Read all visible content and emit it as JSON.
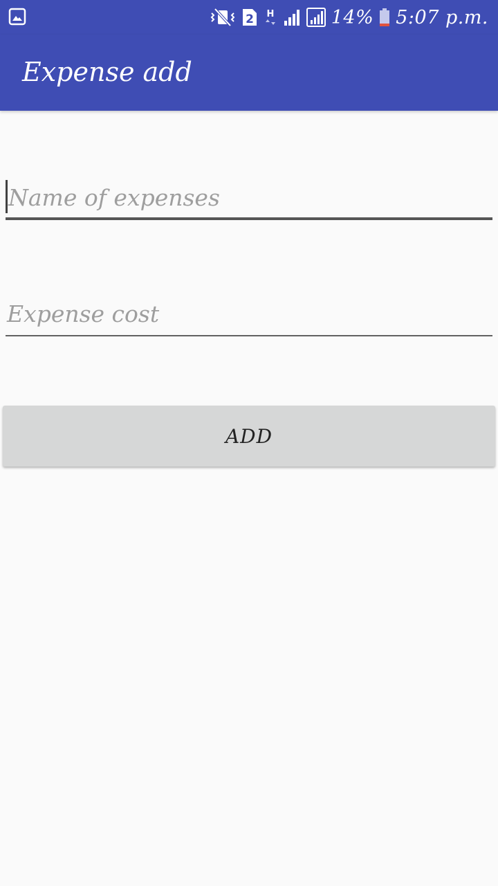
{
  "status_bar": {
    "battery_percent": "14%",
    "clock": "5:07 p.m.",
    "sim_badge": "2",
    "network_type": "H",
    "icons": [
      "gallery-icon",
      "vibrate-icon",
      "sim2-icon",
      "signal-icon",
      "signal-icon",
      "battery-icon"
    ]
  },
  "app_bar": {
    "title": "Expense add",
    "color": "#3f4db4"
  },
  "form": {
    "name_placeholder": "Name of expenses",
    "name_value": "",
    "cost_placeholder": "Expense cost",
    "cost_value": "",
    "add_label": "ADD"
  }
}
